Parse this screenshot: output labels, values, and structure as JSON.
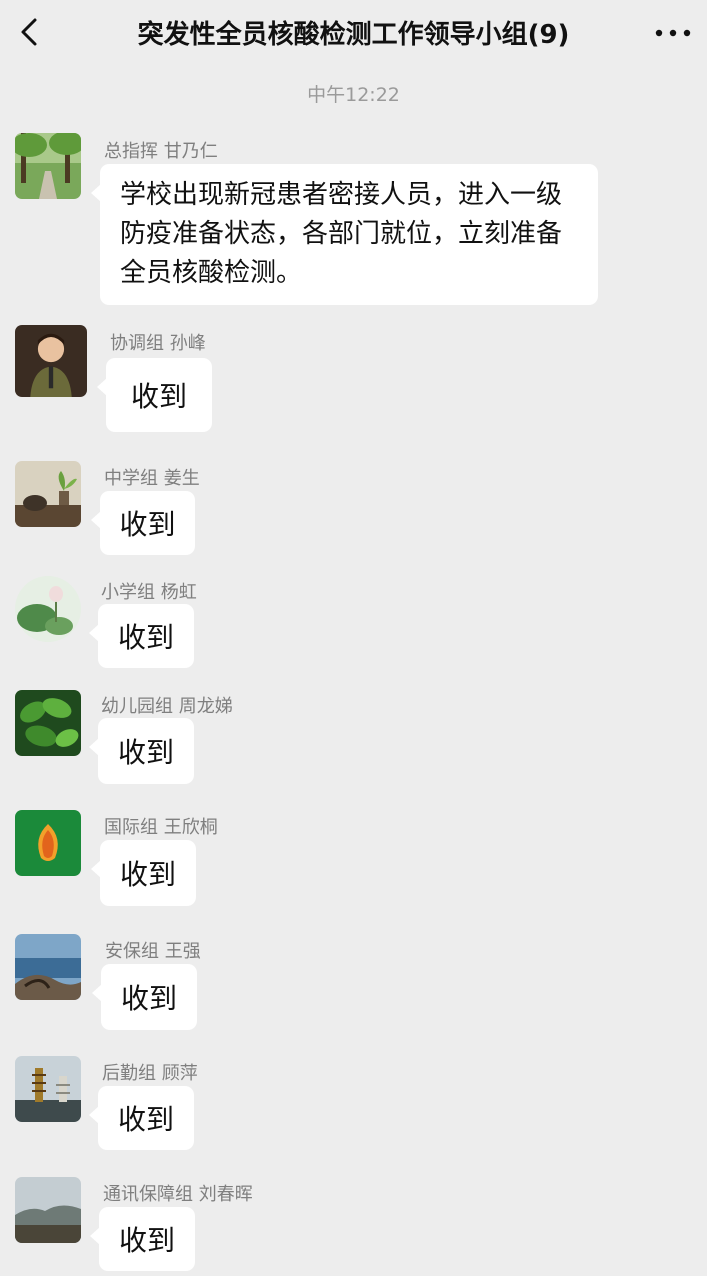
{
  "header": {
    "title": "突发性全员核酸检测工作领导小组(9)",
    "back_icon": "chevron-left-icon",
    "more_icon": "more-dots-icon"
  },
  "timestamp": "中午12:22",
  "messages": [
    {
      "sender": "总指挥 甘乃仁",
      "text": "学校出现新冠患者密接人员，进入一级防疫准备状态，各部门就位，立刻准备全员核酸检测。",
      "avatar": "park-path-avatar"
    },
    {
      "sender": "协调组 孙峰",
      "text": "收到",
      "avatar": "cartoon-person-avatar"
    },
    {
      "sender": "中学组 姜生",
      "text": "收到",
      "avatar": "tea-set-avatar"
    },
    {
      "sender": "小学组 杨虹",
      "text": "收到",
      "avatar": "lotus-avatar"
    },
    {
      "sender": "幼儿园组 周龙娣",
      "text": "收到",
      "avatar": "green-leaves-avatar"
    },
    {
      "sender": "国际组 王欣桐",
      "text": "收到",
      "avatar": "leaf-logo-avatar"
    },
    {
      "sender": "安保组 王强",
      "text": "收到",
      "avatar": "lake-tree-avatar"
    },
    {
      "sender": "后勤组 顾萍",
      "text": "收到",
      "avatar": "pagoda-avatar"
    },
    {
      "sender": "通讯保障组 刘春晖",
      "text": "收到",
      "avatar": "landscape-avatar"
    }
  ]
}
